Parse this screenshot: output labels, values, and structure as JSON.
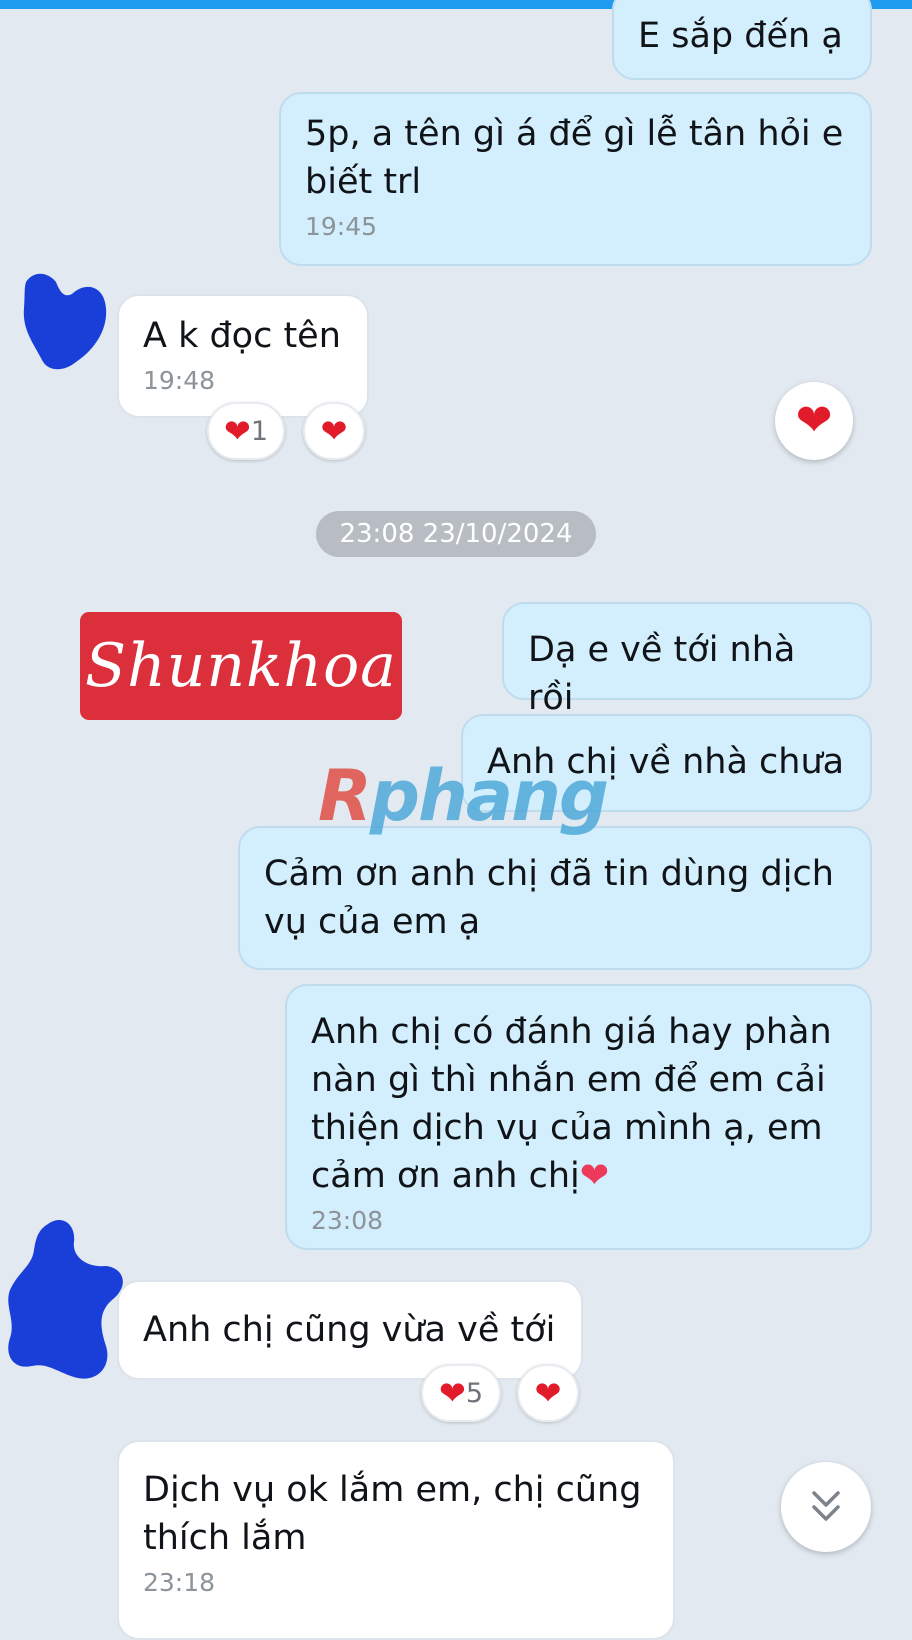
{
  "colors": {
    "background": "#e2e9f1",
    "outgoing_bubble": "#d3eefc",
    "incoming_bubble": "#ffffff",
    "heart": "#e21b2a",
    "logo_background": "#dc2f3c",
    "top_bar": "#1f9bf0"
  },
  "messages": [
    {
      "direction": "out",
      "text": "E sắp đến ạ",
      "time": ""
    },
    {
      "direction": "out",
      "text": "5p, a tên gì á để gì lễ tân hỏi e biết trl",
      "time": "19:45"
    },
    {
      "direction": "in",
      "text": "A k đọc tên",
      "time": "19:48",
      "reaction_count": "1"
    },
    {
      "direction": "out",
      "text": "Dạ e về tới nhà rồi",
      "time": ""
    },
    {
      "direction": "out",
      "text": "Anh chị về nhà chưa",
      "time": ""
    },
    {
      "direction": "out",
      "text": "Cảm ơn anh chị đã tin dùng dịch vụ của em ạ",
      "time": ""
    },
    {
      "direction": "out",
      "text": "Anh chị có đánh giá hay phàn nàn gì thì nhắn em để em cải thiện dịch vụ của mình ạ, em cảm ơn anh chị",
      "time": "23:08"
    },
    {
      "direction": "in",
      "text": "Anh chị cũng vừa về tới",
      "time": "",
      "reaction_count": "5"
    },
    {
      "direction": "in",
      "text": "Dịch vụ ok lắm em, chị cũng thích lắm",
      "time": "23:18"
    }
  ],
  "date_separator": "23:08 23/10/2024",
  "logo_text": "Shunkhoa",
  "watermark": {
    "part1": "R",
    "part2": "phang"
  },
  "icons": {
    "reaction": "heart-icon",
    "react_button": "heart-icon",
    "scroll_down": "double-chevron-down-icon"
  }
}
